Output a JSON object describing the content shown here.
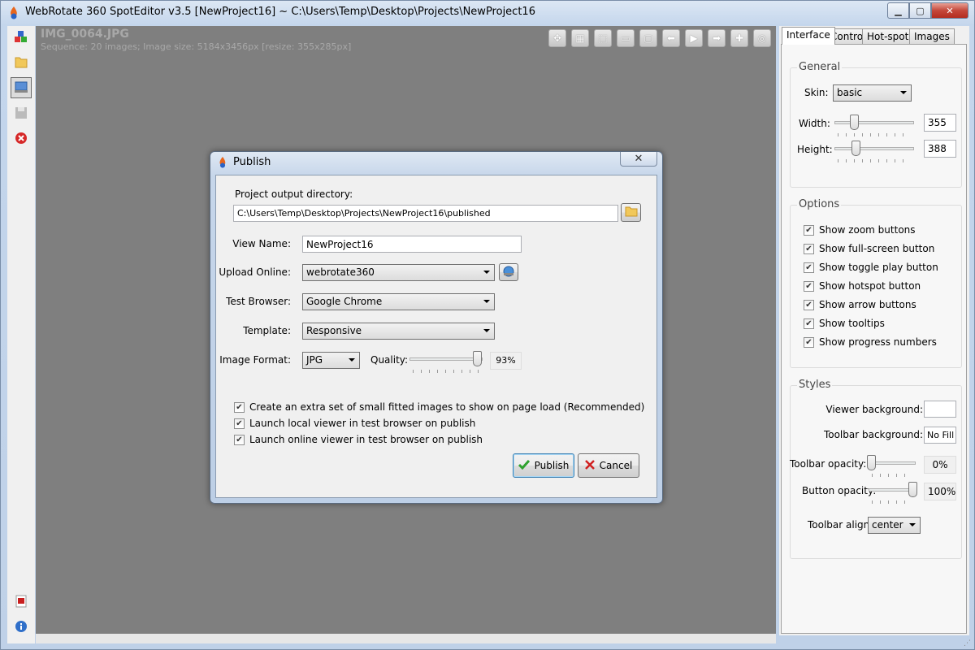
{
  "window": {
    "title": "WebRotate 360 SpotEditor v3.5 [NewProject16] ~ C:\\Users\\Temp\\Desktop\\Projects\\NewProject16",
    "minimize": "▁",
    "maximize": "▢",
    "close": "✕"
  },
  "left_toolbar": {
    "icons": [
      "new-project-icon",
      "open-folder-icon",
      "publish-icon",
      "save-icon",
      "close-project-icon",
      "pdf-help-icon",
      "info-icon"
    ]
  },
  "canvas": {
    "image_name": "IMG_0064.JPG",
    "image_info": "Sequence: 20 images; Image size: 5184x3456px [resize: 355x285px]",
    "toolbar_icons": [
      "move-icon",
      "grid-icon",
      "select-area-icon",
      "filmstrip-icon",
      "fullscreen-icon",
      "arrow-left-icon",
      "play-icon",
      "arrow-right-icon",
      "zoom-in-icon",
      "hotspot-icon"
    ],
    "toolbar_glyphs": [
      "✥",
      "▦",
      "⬚",
      "▭",
      "▢",
      "⬅",
      "▶",
      "➡",
      "✚",
      "◎"
    ]
  },
  "tabs": [
    "Interface",
    "Control",
    "Hot-spots",
    "Images"
  ],
  "general": {
    "title": "General",
    "skin_label": "Skin:",
    "skin_value": "basic",
    "width_label": "Width:",
    "width_value": "355",
    "height_label": "Height:",
    "height_value": "388"
  },
  "options": {
    "title": "Options",
    "items": [
      {
        "label": "Show zoom buttons",
        "checked": true
      },
      {
        "label": "Show full-screen button",
        "checked": true
      },
      {
        "label": "Show toggle play button",
        "checked": true
      },
      {
        "label": "Show hotspot button",
        "checked": true
      },
      {
        "label": "Show arrow buttons",
        "checked": true
      },
      {
        "label": "Show tooltips",
        "checked": true
      },
      {
        "label": "Show progress numbers",
        "checked": true
      }
    ]
  },
  "styles": {
    "title": "Styles",
    "viewer_bg_label": "Viewer background:",
    "viewer_bg_color": "#ffffff",
    "toolbar_bg_label": "Toolbar background:",
    "toolbar_bg_value": "No Fill",
    "toolbar_opacity_label": "Toolbar opacity:",
    "toolbar_opacity_value": "0%",
    "toolbar_opacity_level": 0,
    "button_opacity_label": "Button opacity:",
    "button_opacity_value": "100%",
    "button_opacity_level": 1,
    "toolbar_align_label": "Toolbar align:",
    "toolbar_align_value": "center"
  },
  "dialog": {
    "title": "Publish",
    "close": "✕",
    "output_dir_label": "Project output directory:",
    "output_dir_value": "C:\\Users\\Temp\\Desktop\\Projects\\NewProject16\\published",
    "view_name_label": "View Name:",
    "view_name_value": "NewProject16",
    "upload_label": "Upload Online:",
    "upload_value": "webrotate360",
    "browser_label": "Test Browser:",
    "browser_value": "Google Chrome",
    "template_label": "Template:",
    "template_value": "Responsive",
    "format_label": "Image Format:",
    "format_value": "JPG",
    "quality_label": "Quality:",
    "quality_value": "93%",
    "quality_level": 0.93,
    "checks": [
      {
        "label": "Create an extra set of small fitted images to show on page load (Recommended)",
        "checked": true
      },
      {
        "label": "Launch local viewer in test browser on publish",
        "checked": true
      },
      {
        "label": "Launch online viewer in test browser on publish",
        "checked": true
      }
    ],
    "publish_label": "Publish",
    "cancel_label": "Cancel"
  },
  "colors": {
    "canvas_bg": "#7f7f7f",
    "accent_green": "#2ea12e",
    "cancel_red": "#d02020"
  }
}
